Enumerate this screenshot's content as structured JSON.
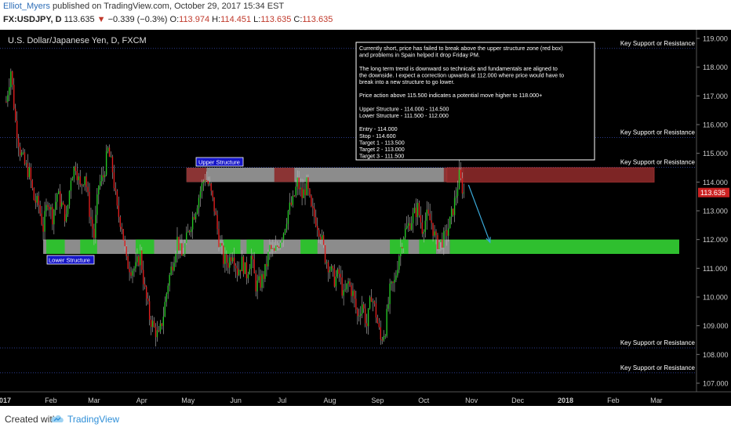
{
  "header": {
    "author": "Elliot_Myers",
    "published_text": "published on TradingView.com, October 29, 2017 15:34 EST",
    "symbol": "FX:USDJPY, D",
    "last": "113.635",
    "change": "−0.339 (−0.3%)",
    "o_label": "O:",
    "o_value": "113.974",
    "h_label": "H:",
    "h_value": "114.451",
    "l_label": "L:",
    "l_value": "113.635",
    "c_label": "C:",
    "c_value": "113.635"
  },
  "chart_data": {
    "type": "candlestick",
    "title": "U.S. Dollar/Japanese Yen, D, FXCM",
    "ylim": [
      106.7,
      119.3
    ],
    "y_ticks": [
      107.0,
      108.0,
      109.0,
      110.0,
      111.0,
      112.0,
      113.0,
      114.0,
      115.0,
      116.0,
      117.0,
      118.0,
      119.0
    ],
    "x_months": [
      "2017",
      "Feb",
      "Mar",
      "Apr",
      "May",
      "Jun",
      "Jul",
      "Aug",
      "Sep",
      "Oct",
      "Nov",
      "Dec",
      "2018",
      "Feb",
      "Mar"
    ],
    "x_month_days": [
      0,
      31,
      59,
      90,
      120,
      151,
      181,
      212,
      243,
      273,
      304,
      334,
      365,
      396,
      424
    ],
    "x_range_days": [
      0,
      450
    ],
    "last_price": 113.635,
    "candle_color_up": "#26c826",
    "candle_color_down": "#e01e1e",
    "key_levels": [
      {
        "value": 118.652,
        "label": "Key Support or Resistance"
      },
      {
        "value": 115.549,
        "label": "Key Support or Resistance"
      },
      {
        "value": 114.515,
        "label": "Key Support or Resistance"
      },
      {
        "value": 108.228,
        "label": "Key Support or Resistance"
      },
      {
        "value": 107.36,
        "label": "Key Support or Resistance"
      }
    ],
    "upper_structure": {
      "label": "Upper Structure",
      "from": 114.0,
      "to": 114.5
    },
    "lower_structure": {
      "label": "Lower Structure",
      "from": 111.5,
      "to": 112.0
    },
    "closes": [
      [
        2,
        116.8
      ],
      [
        5,
        117.9
      ],
      [
        8,
        116.1
      ],
      [
        11,
        115.1
      ],
      [
        14,
        114.6
      ],
      [
        17,
        114.3
      ],
      [
        20,
        113.4
      ],
      [
        23,
        113.2
      ],
      [
        26,
        112.4
      ],
      [
        29,
        113.4
      ],
      [
        32,
        112.8
      ],
      [
        35,
        113.6
      ],
      [
        38,
        113.2
      ],
      [
        41,
        112.7
      ],
      [
        44,
        114.2
      ],
      [
        47,
        114.6
      ],
      [
        50,
        113.8
      ],
      [
        53,
        114.3
      ],
      [
        56,
        113.0
      ],
      [
        59,
        112.1
      ],
      [
        62,
        113.9
      ],
      [
        65,
        114.2
      ],
      [
        68,
        115.1
      ],
      [
        71,
        114.4
      ],
      [
        74,
        113.0
      ],
      [
        77,
        112.5
      ],
      [
        80,
        111.2
      ],
      [
        83,
        111.0
      ],
      [
        86,
        111.0
      ],
      [
        89,
        111.5
      ],
      [
        92,
        110.2
      ],
      [
        95,
        109.3
      ],
      [
        98,
        108.9
      ],
      [
        101,
        108.6
      ],
      [
        104,
        109.4
      ],
      [
        107,
        110.5
      ],
      [
        110,
        111.2
      ],
      [
        113,
        112.0
      ],
      [
        116,
        111.4
      ],
      [
        119,
        112.0
      ],
      [
        122,
        112.6
      ],
      [
        125,
        113.1
      ],
      [
        128,
        113.7
      ],
      [
        131,
        114.2
      ],
      [
        134,
        113.8
      ],
      [
        137,
        113.1
      ],
      [
        140,
        112.0
      ],
      [
        143,
        111.3
      ],
      [
        146,
        111.2
      ],
      [
        149,
        111.6
      ],
      [
        152,
        110.9
      ],
      [
        155,
        111.2
      ],
      [
        158,
        110.8
      ],
      [
        161,
        111.4
      ],
      [
        164,
        110.4
      ],
      [
        167,
        110.5
      ],
      [
        170,
        110.9
      ],
      [
        173,
        111.7
      ],
      [
        176,
        111.5
      ],
      [
        179,
        111.9
      ],
      [
        182,
        112.3
      ],
      [
        185,
        113.0
      ],
      [
        188,
        113.3
      ],
      [
        191,
        114.0
      ],
      [
        194,
        113.5
      ],
      [
        197,
        113.9
      ],
      [
        200,
        113.0
      ],
      [
        203,
        112.7
      ],
      [
        206,
        112.2
      ],
      [
        209,
        111.4
      ],
      [
        212,
        111.0
      ],
      [
        215,
        110.6
      ],
      [
        218,
        110.8
      ],
      [
        221,
        110.0
      ],
      [
        224,
        110.5
      ],
      [
        227,
        110.1
      ],
      [
        230,
        109.3
      ],
      [
        233,
        109.8
      ],
      [
        236,
        109.0
      ],
      [
        239,
        110.1
      ],
      [
        242,
        109.4
      ],
      [
        245,
        108.5
      ],
      [
        248,
        108.9
      ],
      [
        251,
        110.2
      ],
      [
        254,
        110.5
      ],
      [
        257,
        111.5
      ],
      [
        260,
        112.2
      ],
      [
        263,
        112.5
      ],
      [
        266,
        112.8
      ],
      [
        269,
        113.1
      ],
      [
        272,
        112.4
      ],
      [
        275,
        112.8
      ],
      [
        278,
        112.6
      ],
      [
        281,
        111.9
      ],
      [
        284,
        111.9
      ],
      [
        287,
        112.1
      ],
      [
        290,
        112.6
      ],
      [
        293,
        113.3
      ],
      [
        296,
        114.2
      ],
      [
        299,
        113.6
      ]
    ],
    "projection": {
      "from_day": 299,
      "from_value": 113.9,
      "to_day": 316,
      "to_value": 111.9
    }
  },
  "annotation": {
    "lines": [
      "Currently short, price has failed to break above the upper structure zone (red box)",
      "and problems in Spain helped it drop Friday PM.",
      "",
      "The long term trend is downward so technicals and fundamentals are aligned to",
      "the downside. I expect a correction upwards at 112.000 where price would have to",
      "break into a new structure to go lower.",
      "",
      "Price action above 115.500 indicates a potential move higher to 118.000+",
      "",
      "Upper Structure - 114.000 - 114.500",
      "Lower Structure - 111.500 - 112.000",
      "",
      "Entry - 114.000",
      "Stop - 114.600",
      "Target 1 - 113.500",
      "Target 2 - 113.000",
      "Target 3 - 111.500"
    ]
  },
  "footer": {
    "created_with": "Created with",
    "brand": "TradingView"
  },
  "colors": {
    "background": "#000000",
    "grid_line": "#2a3a8a",
    "axis_text": "#cccccc",
    "up_candle": "#26c826",
    "down_candle": "#e01e1e",
    "zone_gray": "#8c8c8c",
    "zone_red": "#8b2a2a",
    "zone_green": "#2fbf2f",
    "label_blue": "#1515c8",
    "price_tag_blue": "#2b6cb0",
    "price_tag_red": "#cc2222",
    "projection_line": "#3aa9d8"
  }
}
